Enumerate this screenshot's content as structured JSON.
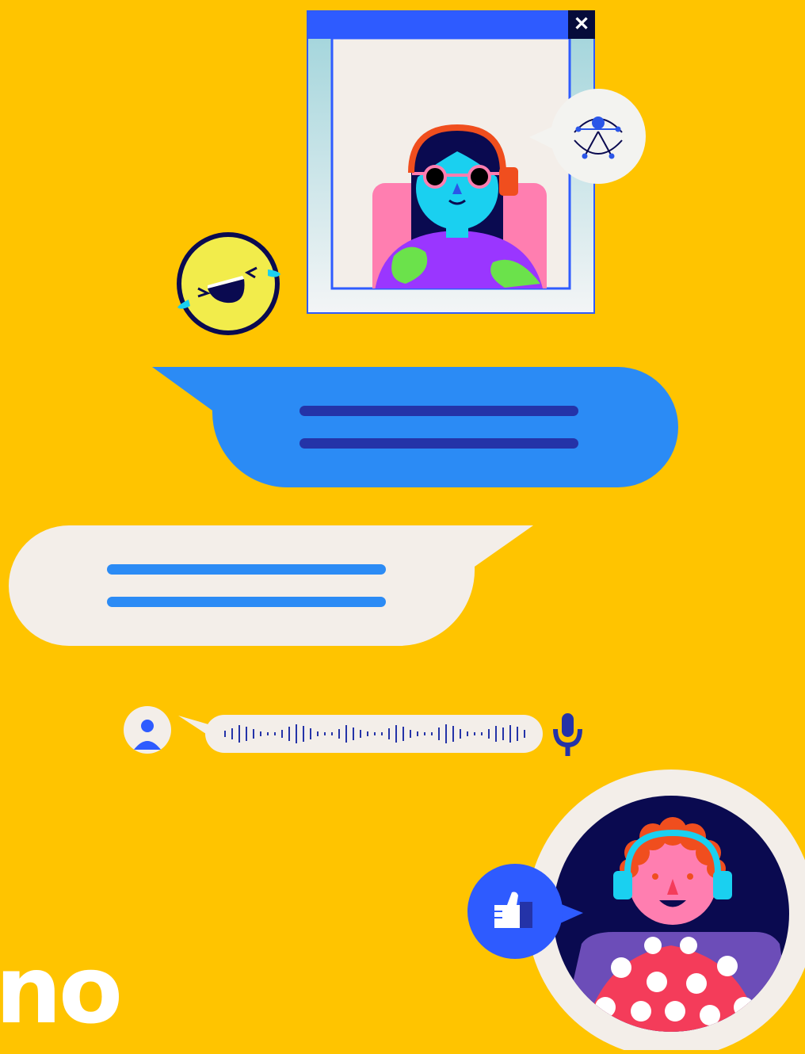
{
  "brand": {
    "text": "no"
  },
  "window": {
    "close_glyph": "✕",
    "close_icon": "close-icon"
  },
  "chat": {
    "incoming_bubble_lines": 2,
    "outgoing_bubble_lines": 2
  },
  "voice": {
    "mic_icon": "microphone-icon",
    "avatar_icon": "user-icon"
  },
  "reactions": {
    "laugh_icon": "laughing-emoji-icon",
    "thumbs_up_icon": "thumbs-up-icon",
    "accessibility_icon": "accessibility-icon"
  },
  "colors": {
    "background": "#FFC400",
    "blue": "#2B8BF5",
    "navy": "#2433A8",
    "cream": "#F3EEE9",
    "window_bar": "#2E5BFF"
  }
}
